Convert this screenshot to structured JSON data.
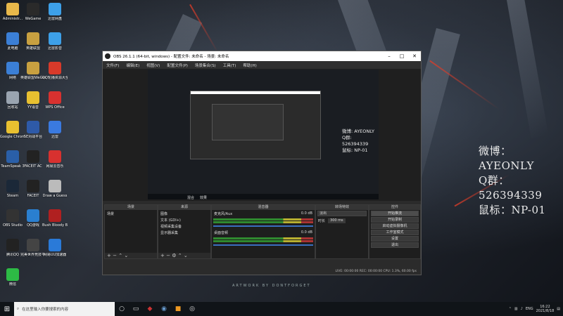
{
  "desktop_icons": [
    {
      "label": "Administr...",
      "color": "#e8b84a",
      "icon": "user-folder-icon"
    },
    {
      "label": "WeGame",
      "color": "#2a2a2a",
      "icon": "wegame-icon"
    },
    {
      "label": "迅雷网盘",
      "color": "#3da0e8",
      "icon": "cloud-drive-icon"
    },
    {
      "label": "此电脑",
      "color": "#3b7fd6",
      "icon": "computer-icon"
    },
    {
      "label": "英雄联盟",
      "color": "#c8a040",
      "icon": "lol-icon"
    },
    {
      "label": "迅雷影音",
      "color": "#3da0e8",
      "icon": "video-player-icon"
    },
    {
      "label": "网络",
      "color": "#3b7fd6",
      "icon": "network-icon"
    },
    {
      "label": "英雄联盟WeGame版",
      "color": "#c8a040",
      "icon": "lol-wegame-icon"
    },
    {
      "label": "QQ轮播资源大全",
      "color": "#d83a2a",
      "icon": "qq-icon"
    },
    {
      "label": "回收站",
      "color": "#9aa4b0",
      "icon": "recycle-bin-icon"
    },
    {
      "label": "YY语音",
      "color": "#e8c030",
      "icon": "yy-icon"
    },
    {
      "label": "WPS Office",
      "color": "#d8312f",
      "icon": "wps-icon"
    },
    {
      "label": "Google Chrome",
      "color": "#e8c030",
      "icon": "chrome-icon"
    },
    {
      "label": "5E对战平台",
      "color": "#2e5aa8",
      "icon": "5e-icon"
    },
    {
      "label": "迅雷",
      "color": "#3a7ae0",
      "icon": "thunder-icon"
    },
    {
      "label": "TeamSpeak 3",
      "color": "#2a5fa8",
      "icon": "teamspeak-icon"
    },
    {
      "label": "FACEIT AC",
      "color": "#222",
      "icon": "faceit-ac-icon"
    },
    {
      "label": "网易云音乐",
      "color": "#d8312f",
      "icon": "netease-music-icon"
    },
    {
      "label": "Steam",
      "color": "#1b2838",
      "icon": "steam-icon"
    },
    {
      "label": "FACEIT",
      "color": "#222",
      "icon": "faceit-icon"
    },
    {
      "label": "Draw a Guess",
      "color": "#bbb",
      "icon": "draw-guess-icon"
    },
    {
      "label": "OBS Studio",
      "color": "#333",
      "icon": "obs-icon"
    },
    {
      "label": "QQ游戏",
      "color": "#2a7fd0",
      "icon": "qq-game-icon"
    },
    {
      "label": "Bush Bloody Bee",
      "color": "#b02020",
      "icon": "game-icon"
    },
    {
      "label": "腾讯QQ",
      "color": "#222",
      "icon": "tencent-qq-icon"
    },
    {
      "label": "完美世界竞技平台",
      "color": "#444",
      "icon": "perfect-world-icon"
    },
    {
      "label": "网易UU加速器",
      "color": "#2a7ad8",
      "icon": "uu-icon"
    },
    {
      "label": "微信",
      "color": "#2dbb45",
      "icon": "wechat-icon"
    }
  ],
  "overlay": {
    "line1": "微博：AYEONLY",
    "line2": "Q群：526394339",
    "line3": "鼠标：NP-01"
  },
  "obs": {
    "title": "OBS 26.1.1 (64-bit, windows) - 配置文件: 未命名 - 场景: 未命名",
    "menu": [
      "文件(F)",
      "编辑(E)",
      "视图(V)",
      "配置文件(P)",
      "场景集合(S)",
      "工具(T)",
      "帮助(H)"
    ],
    "preview_labels": [
      "微博: AYEONLY",
      "Q群: 526394339",
      "鼠标: NP-01"
    ],
    "mode_tabs": [
      "混合",
      "效果"
    ],
    "panels": {
      "scenes": {
        "title": "场景",
        "items": [
          "场景"
        ]
      },
      "sources": {
        "title": "来源",
        "items": [
          "图像",
          "文本 (GDI+)",
          "视频采集设备",
          "显示器采集"
        ]
      },
      "mixer": {
        "title": "混音器",
        "tracks": [
          {
            "name": "麦克风/Aux",
            "db": "0.0 dB"
          },
          {
            "name": "桌面音频",
            "db": "0.0 dB"
          }
        ]
      },
      "transitions": {
        "title": "转场特效",
        "type": "淡出",
        "duration_label": "时长",
        "duration": "300 ms"
      },
      "controls": {
        "title": "控件",
        "buttons": [
          "开始推流",
          "开始录制",
          "启动虚拟摄像机",
          "工作室模式",
          "设置",
          "退出"
        ]
      }
    },
    "statusbar": "LIVE: 00:00:00   REC: 00:00:00   CPU: 1.3%, 60.00 fps"
  },
  "watermark": "ARTWORK BY DONTFORGET",
  "taskbar": {
    "search_placeholder": "在这里输入你要搜索的内容",
    "lang": "ENG",
    "time": "16:22",
    "date": "2021/8/18"
  }
}
